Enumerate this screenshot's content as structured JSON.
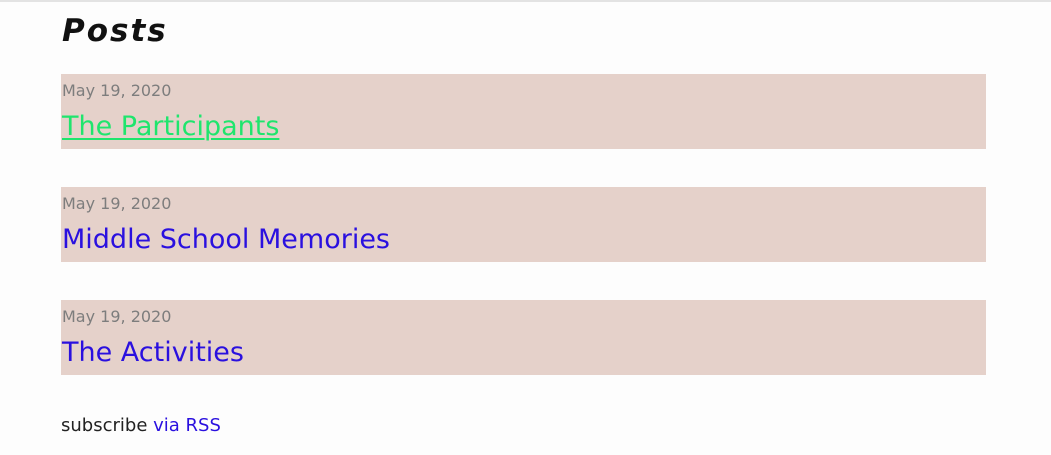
{
  "page": {
    "title": "Posts"
  },
  "posts": [
    {
      "date": "May 19, 2020",
      "title": "The Participants"
    },
    {
      "date": "May 19, 2020",
      "title": "Middle School Memories"
    },
    {
      "date": "May 19, 2020",
      "title": "The Activities"
    }
  ],
  "footer": {
    "subscribe_text": "subscribe",
    "rss_link": "via RSS"
  },
  "colors": {
    "post_background": "#e5d1ca",
    "link": "#2a10df",
    "active_link": "#1fe56d",
    "date_text": "#7d7d7d"
  }
}
